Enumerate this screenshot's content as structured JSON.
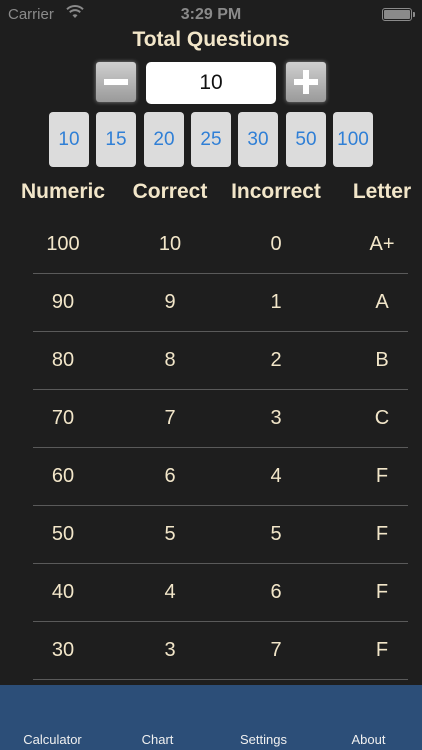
{
  "status": {
    "carrier": "Carrier",
    "time": "3:29 PM",
    "wifi_icon": "wifi-icon",
    "battery_icon": "battery-icon"
  },
  "title": "Total Questions",
  "stepper": {
    "value": "10",
    "minus_icon": "minus-icon",
    "plus_icon": "plus-icon"
  },
  "presets": [
    "10",
    "15",
    "20",
    "25",
    "30",
    "50",
    "100"
  ],
  "table": {
    "headers": [
      "Numeric",
      "Correct",
      "Incorrect",
      "Letter"
    ],
    "rows": [
      [
        "100",
        "10",
        "0",
        "A+"
      ],
      [
        "90",
        "9",
        "1",
        "A"
      ],
      [
        "80",
        "8",
        "2",
        "B"
      ],
      [
        "70",
        "7",
        "3",
        "C"
      ],
      [
        "60",
        "6",
        "4",
        "F"
      ],
      [
        "50",
        "5",
        "5",
        "F"
      ],
      [
        "40",
        "4",
        "6",
        "F"
      ],
      [
        "30",
        "3",
        "7",
        "F"
      ]
    ]
  },
  "tabs": [
    "Calculator",
    "Chart",
    "Settings",
    "About"
  ],
  "colors": {
    "background": "#1e1e1e",
    "text": "#f2e6c9",
    "preset_text": "#2f7fd6",
    "tabbar": "#2c4e78"
  }
}
